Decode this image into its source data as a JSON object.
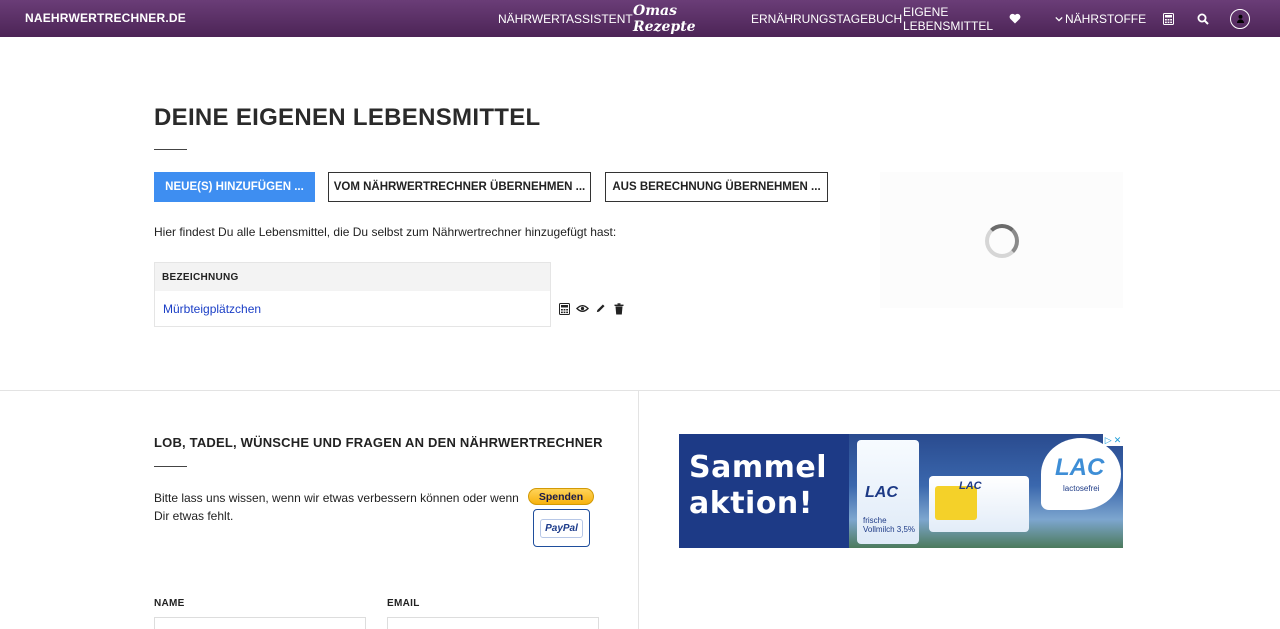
{
  "site": {
    "brand": "NAEHRWERTRECHNER.DE"
  },
  "nav": {
    "items": [
      {
        "label": "NÄHRWERTASSISTENT"
      },
      {
        "label": "Omas Rezepte"
      },
      {
        "label": "ERNÄHRUNGSTAGEBUCH"
      },
      {
        "label": "EIGENE LEBENSMITTEL"
      },
      {
        "label": "NÄHRSTOFFE"
      }
    ],
    "icons": [
      "heart-icon",
      "chevron-down-icon",
      "calculator-icon",
      "search-icon",
      "user-icon"
    ]
  },
  "main": {
    "title": "DEINE EIGENEN LEBENSMITTEL",
    "buttons": {
      "add_new": "NEUE(S) HINZUFÜGEN ...",
      "from_calculator": "VOM NÄHRWERTRECHNER ÜBERNEHMEN ...",
      "from_calculation": "AUS BERECHNUNG ÜBERNEHMEN ..."
    },
    "intro": "Hier findest Du alle Lebensmittel, die Du selbst zum Nährwertrechner hinzugefügt hast:",
    "table": {
      "header": "BEZEICHNUNG",
      "rows": [
        {
          "name": "Mürbteigplätzchen"
        }
      ]
    },
    "row_actions": [
      "calculator-icon",
      "eye-icon",
      "pencil-icon",
      "trash-icon"
    ]
  },
  "feedback": {
    "title": "LOB, TADEL, WÜNSCHE UND FRAGEN AN DEN NÄHRWERTRECHNER",
    "text": "Bitte lass uns wissen, wenn wir etwas verbessern können oder wenn Dir etwas fehlt.",
    "donate_label": "Spenden",
    "paypal_label": "PayPal",
    "form": {
      "name_label": "NAME",
      "email_label": "EMAIL"
    }
  },
  "ad": {
    "headline_line1": "Sammel",
    "headline_line2": "aktion!",
    "brand": "LAC",
    "brand_sub": "lactosefrei",
    "product1_logo": "LAC",
    "product1_text": "frische Vollmilch 3,5%",
    "product2_logo": "LAC",
    "colors": {
      "navy": "#1d3a86",
      "accent": "#3e8ed6"
    }
  },
  "colors": {
    "nav_bg": "#5a2f66",
    "primary_button": "#3e8ef1",
    "link": "#1a3ec6"
  }
}
